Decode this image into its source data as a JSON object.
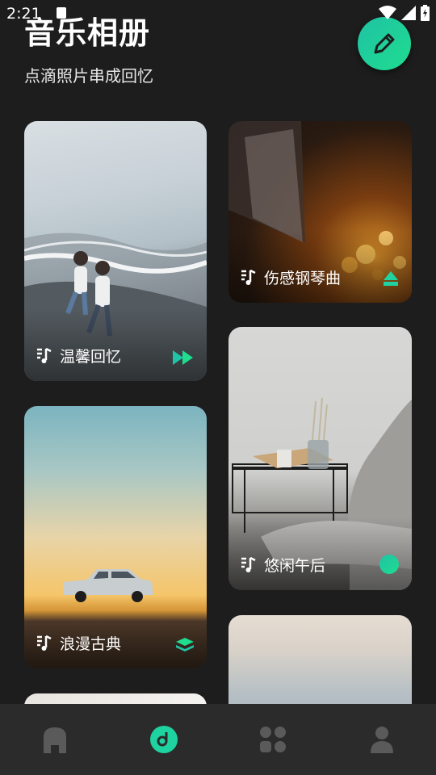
{
  "status": {
    "time": "2:21"
  },
  "header": {
    "title": "音乐相册",
    "subtitle": "点滴照片串成回忆"
  },
  "fab": {
    "icon": "pencil-icon"
  },
  "albums": [
    {
      "title": "温馨回忆",
      "badge_icon": "fast-forward-icon"
    },
    {
      "title": "伤感钢琴曲",
      "badge_icon": "eject-up-icon"
    },
    {
      "title": "浪漫古典",
      "badge_icon": "layers-icon"
    },
    {
      "title": "悠闲午后",
      "badge_icon": "circle-icon"
    }
  ],
  "tabs": [
    {
      "icon": "home-icon",
      "active": false
    },
    {
      "icon": "music-disc-icon",
      "active": true
    },
    {
      "icon": "apps-grid-icon",
      "active": false
    },
    {
      "icon": "profile-icon",
      "active": false
    }
  ],
  "colors": {
    "accent": "#1fd3a0",
    "background": "#1d1d1d",
    "tabbar": "#2b2b2b",
    "inactive_icon": "#5a5a5a"
  }
}
